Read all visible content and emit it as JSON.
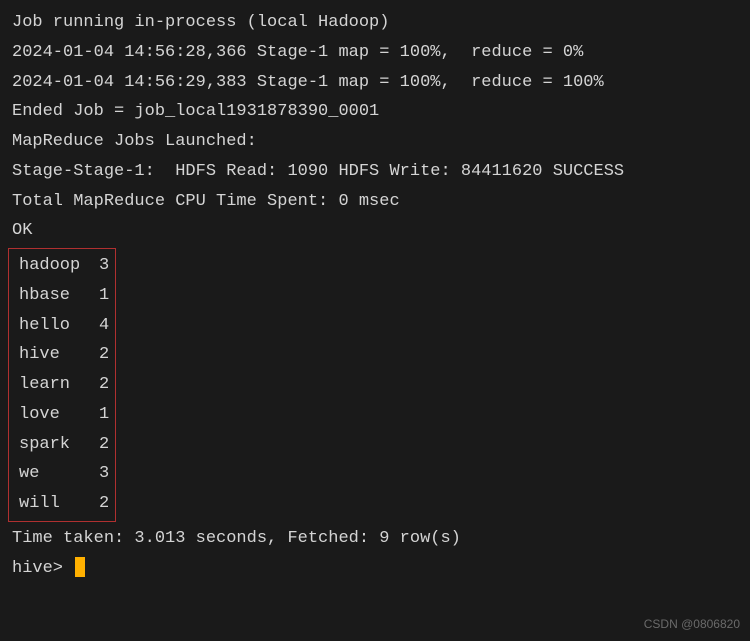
{
  "log": {
    "running": "Job running in-process (local Hadoop)",
    "stage_a": "2024-01-04 14:56:28,366 Stage-1 map = 100%,  reduce = 0%",
    "stage_b": "2024-01-04 14:56:29,383 Stage-1 map = 100%,  reduce = 100%",
    "ended": "Ended Job = job_local1931878390_0001",
    "launched": "MapReduce Jobs Launched:",
    "stage_summary": "Stage-Stage-1:  HDFS Read: 1090 HDFS Write: 84411620 SUCCESS",
    "cpu_time": "Total MapReduce CPU Time Spent: 0 msec",
    "ok": "OK",
    "time_taken": "Time taken: 3.013 seconds, Fetched: 9 row(s)",
    "prompt": "hive> "
  },
  "results": [
    {
      "key": "hadoop",
      "value": "3"
    },
    {
      "key": "hbase",
      "value": "1"
    },
    {
      "key": "hello",
      "value": "4"
    },
    {
      "key": "hive",
      "value": "2"
    },
    {
      "key": "learn",
      "value": "2"
    },
    {
      "key": "love",
      "value": "1"
    },
    {
      "key": "spark",
      "value": "2"
    },
    {
      "key": "we",
      "value": "3"
    },
    {
      "key": "will",
      "value": "2"
    }
  ],
  "watermark": "CSDN @0806820"
}
